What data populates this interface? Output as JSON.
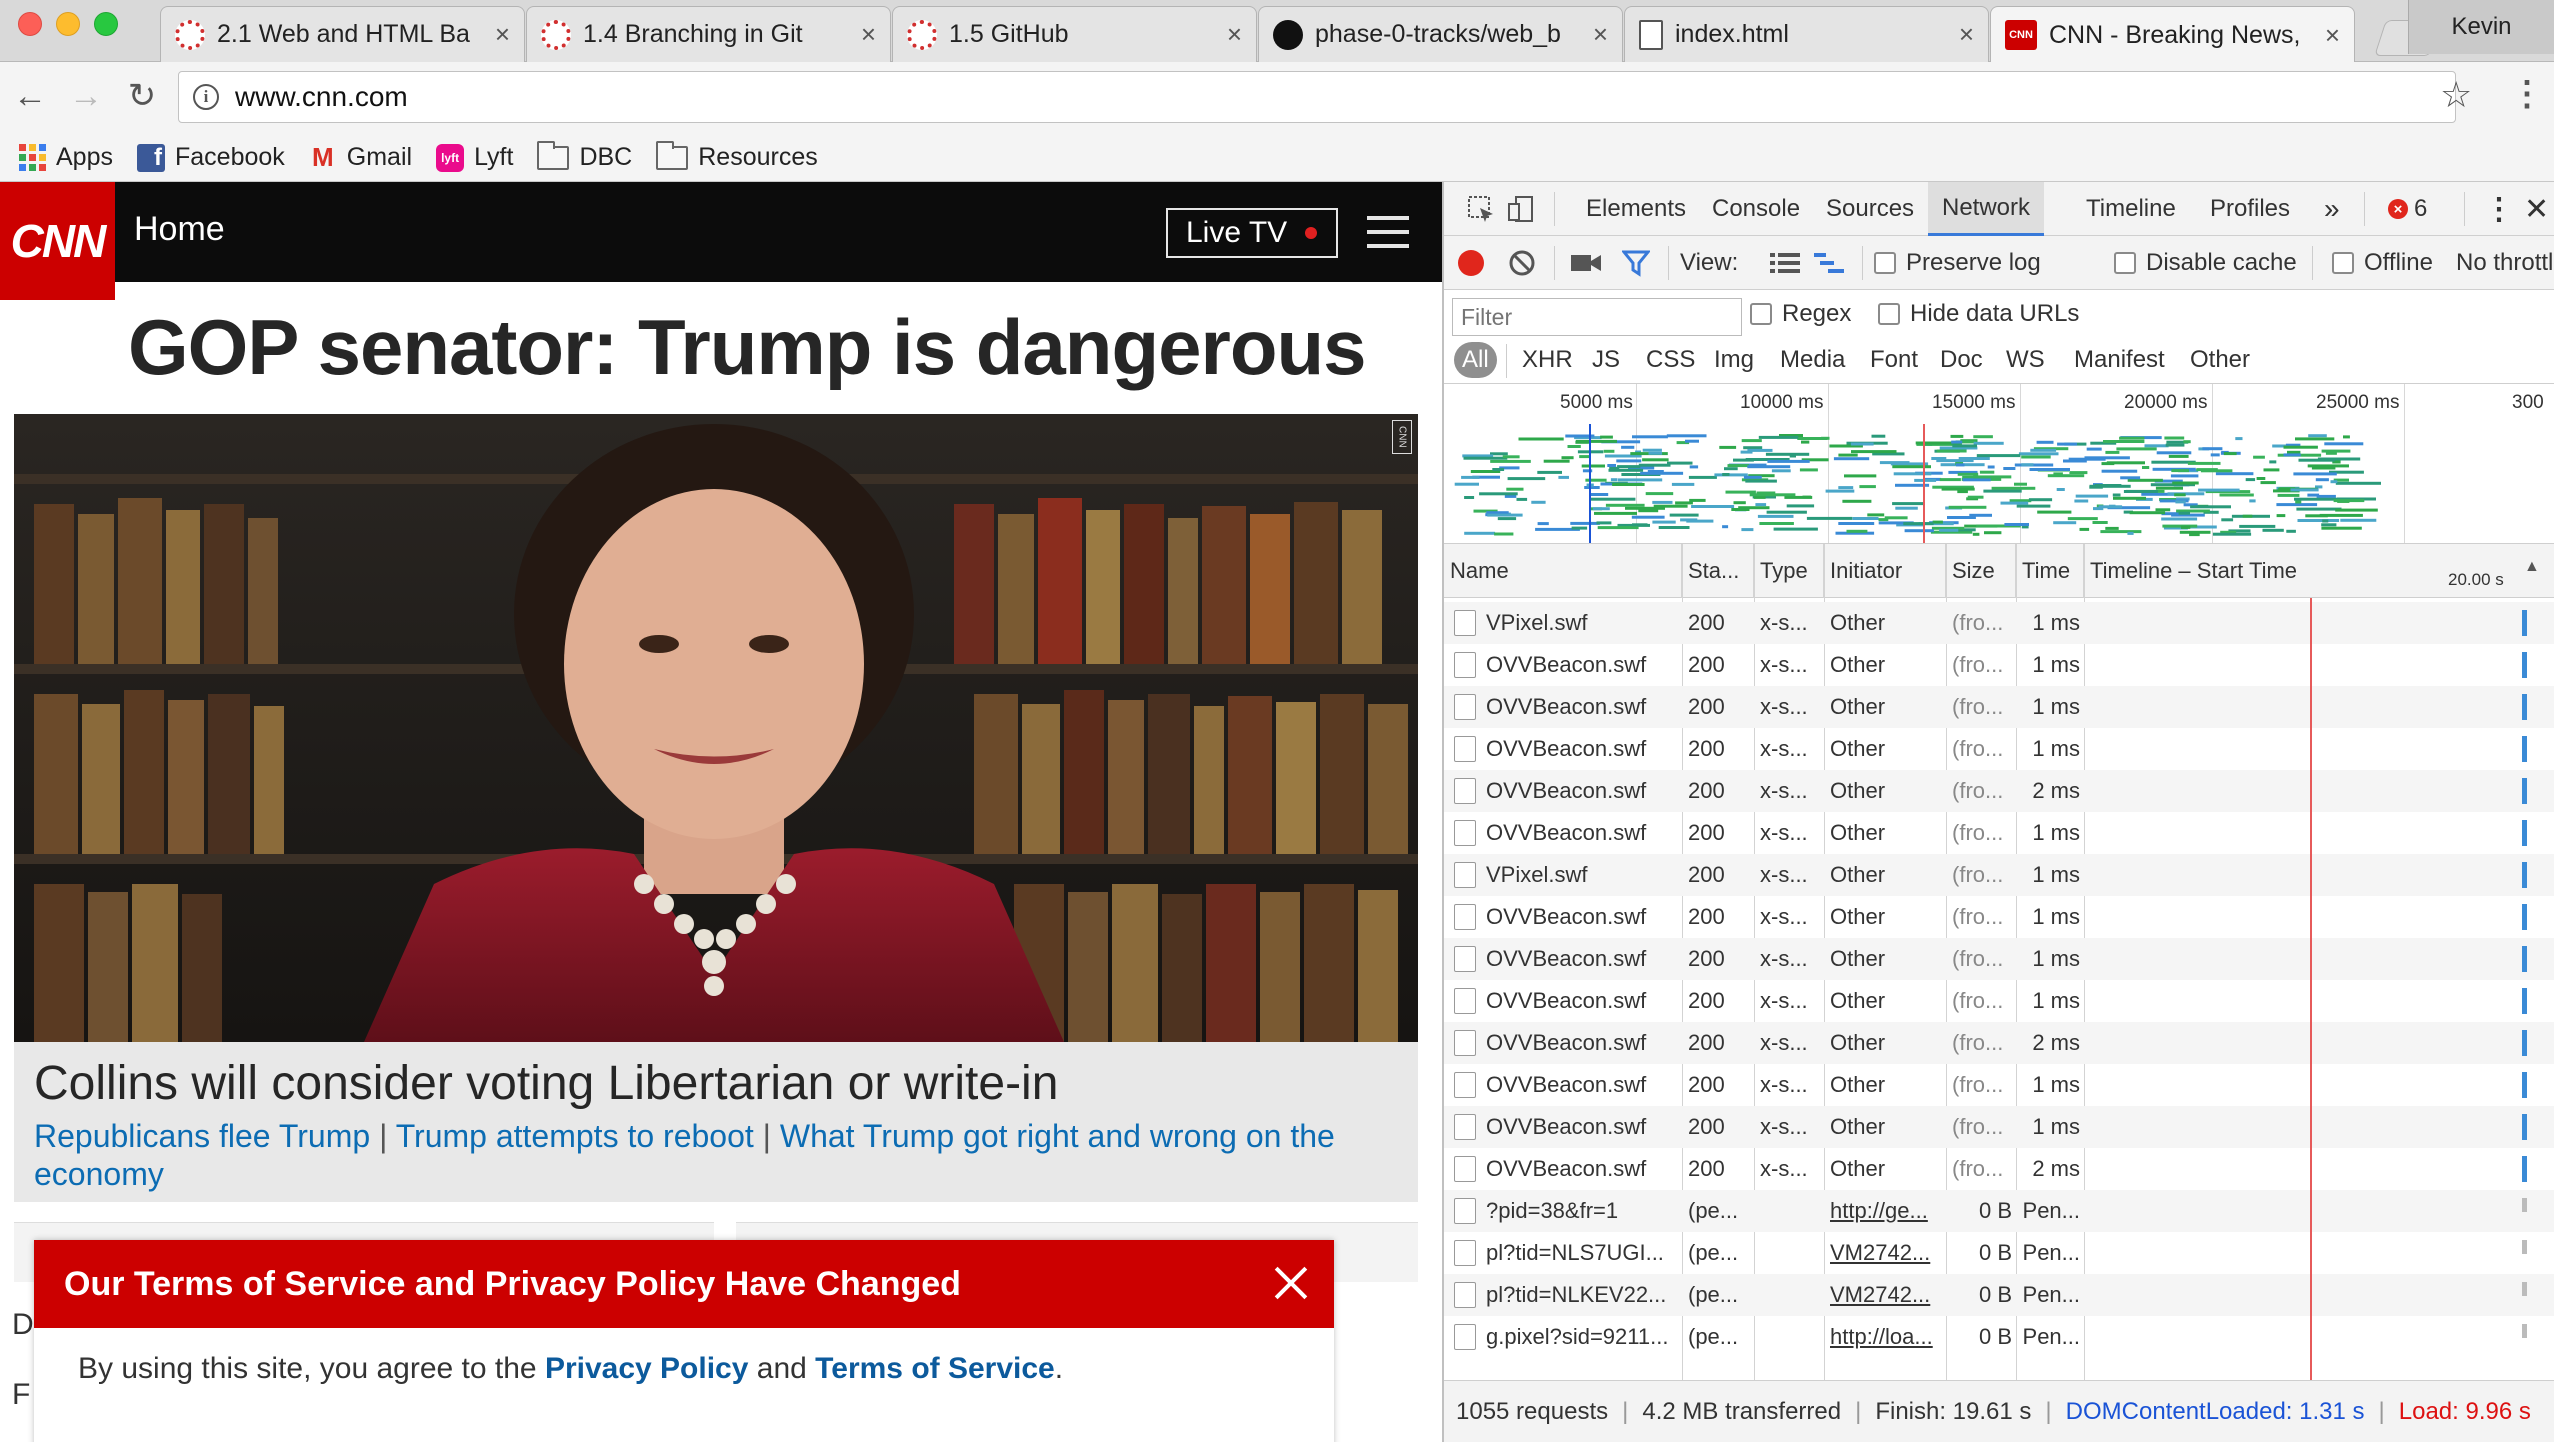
{
  "window": {
    "tabs": [
      {
        "title": "2.1 Web and HTML Ba",
        "icon": "gear-favicon"
      },
      {
        "title": "1.4 Branching in Git",
        "icon": "gear-favicon"
      },
      {
        "title": "1.5 GitHub",
        "icon": "gear-favicon"
      },
      {
        "title": "phase-0-tracks/web_b",
        "icon": "github-favicon"
      },
      {
        "title": "index.html",
        "icon": "document-favicon"
      },
      {
        "title": "CNN - Breaking News,",
        "icon": "cnn-favicon",
        "active": true
      }
    ],
    "tab_close_glyph": "×",
    "profile_name": "Kevin",
    "url": "www.cnn.com"
  },
  "bookmarks": [
    {
      "label": "Apps",
      "icon": "apps-grid-icon"
    },
    {
      "label": "Facebook",
      "icon": "facebook-icon"
    },
    {
      "label": "Gmail",
      "icon": "gmail-icon"
    },
    {
      "label": "Lyft",
      "icon": "lyft-icon"
    },
    {
      "label": "DBC",
      "icon": "folder-icon"
    },
    {
      "label": "Resources",
      "icon": "folder-icon"
    }
  ],
  "cnn": {
    "logo": "CNN",
    "nav_home": "Home",
    "live_tv": "Live TV",
    "headline": "GOP senator: Trump is dangerous",
    "photo_badge": "CNN",
    "caption_title": "Collins will consider voting Libertarian or write-in",
    "caption_links": [
      "Republicans flee Trump",
      "Trump attempts to reboot",
      "What Trump got right and wrong on the economy"
    ],
    "link_separator": "|",
    "cut_letters": [
      "D",
      "F"
    ],
    "tos": {
      "title": "Our Terms of Service and Privacy Policy Have Changed",
      "body_prefix": "By using this site, you agree to the",
      "privacy_link": "Privacy Policy",
      "and": "and",
      "terms_link": "Terms of Service",
      "suffix": "."
    }
  },
  "devtools": {
    "panels": [
      "Elements",
      "Console",
      "Sources",
      "Network",
      "Timeline",
      "Profiles"
    ],
    "active_panel": "Network",
    "more_glyph": "»",
    "error_count": "6",
    "toolbar": {
      "view_label": "View:",
      "preserve_log": "Preserve log",
      "disable_cache": "Disable cache",
      "offline": "Offline",
      "throttling": "No throttl"
    },
    "filter_placeholder": "Filter",
    "regex": "Regex",
    "hide_data_urls": "Hide data URLs",
    "types": [
      "All",
      "XHR",
      "JS",
      "CSS",
      "Img",
      "Media",
      "Font",
      "Doc",
      "WS",
      "Manifest",
      "Other"
    ],
    "overview_ticks": [
      "5000 ms",
      "10000 ms",
      "15000 ms",
      "20000 ms",
      "25000 ms",
      "300"
    ],
    "columns": [
      "Name",
      "Sta...",
      "Type",
      "Initiator",
      "Size",
      "Time",
      "Timeline – Start Time"
    ],
    "timeline_scale": "20.00 s",
    "rows": [
      {
        "name": "VPixel.swf",
        "status": "200",
        "type": "x-s...",
        "initiator": "Other",
        "size": "(fro...",
        "time": "1 ms"
      },
      {
        "name": "OVVBeacon.swf",
        "status": "200",
        "type": "x-s...",
        "initiator": "Other",
        "size": "(fro...",
        "time": "1 ms"
      },
      {
        "name": "OVVBeacon.swf",
        "status": "200",
        "type": "x-s...",
        "initiator": "Other",
        "size": "(fro...",
        "time": "1 ms"
      },
      {
        "name": "OVVBeacon.swf",
        "status": "200",
        "type": "x-s...",
        "initiator": "Other",
        "size": "(fro...",
        "time": "1 ms"
      },
      {
        "name": "OVVBeacon.swf",
        "status": "200",
        "type": "x-s...",
        "initiator": "Other",
        "size": "(fro...",
        "time": "2 ms"
      },
      {
        "name": "OVVBeacon.swf",
        "status": "200",
        "type": "x-s...",
        "initiator": "Other",
        "size": "(fro...",
        "time": "1 ms"
      },
      {
        "name": "VPixel.swf",
        "status": "200",
        "type": "x-s...",
        "initiator": "Other",
        "size": "(fro...",
        "time": "1 ms"
      },
      {
        "name": "OVVBeacon.swf",
        "status": "200",
        "type": "x-s...",
        "initiator": "Other",
        "size": "(fro...",
        "time": "1 ms"
      },
      {
        "name": "OVVBeacon.swf",
        "status": "200",
        "type": "x-s...",
        "initiator": "Other",
        "size": "(fro...",
        "time": "1 ms"
      },
      {
        "name": "OVVBeacon.swf",
        "status": "200",
        "type": "x-s...",
        "initiator": "Other",
        "size": "(fro...",
        "time": "1 ms"
      },
      {
        "name": "OVVBeacon.swf",
        "status": "200",
        "type": "x-s...",
        "initiator": "Other",
        "size": "(fro...",
        "time": "2 ms"
      },
      {
        "name": "OVVBeacon.swf",
        "status": "200",
        "type": "x-s...",
        "initiator": "Other",
        "size": "(fro...",
        "time": "1 ms"
      },
      {
        "name": "OVVBeacon.swf",
        "status": "200",
        "type": "x-s...",
        "initiator": "Other",
        "size": "(fro...",
        "time": "1 ms"
      },
      {
        "name": "OVVBeacon.swf",
        "status": "200",
        "type": "x-s...",
        "initiator": "Other",
        "size": "(fro...",
        "time": "2 ms"
      },
      {
        "name": "?pid=38&fr=1",
        "status": "(pe...",
        "type": "",
        "initiator": "http://ge...",
        "size": "0 B",
        "time": "Pen..."
      },
      {
        "name": "pl?tid=NLS7UGI...",
        "status": "(pe...",
        "type": "",
        "initiator": "VM2742...",
        "size": "0 B",
        "time": "Pen..."
      },
      {
        "name": "pl?tid=NLKEV22...",
        "status": "(pe...",
        "type": "",
        "initiator": "VM2742...",
        "size": "0 B",
        "time": "Pen..."
      },
      {
        "name": "g.pixel?sid=9211...",
        "status": "(pe...",
        "type": "",
        "initiator": "http://loa...",
        "size": "0 B",
        "time": "Pen..."
      }
    ],
    "status_bar": {
      "requests": "1055 requests",
      "transferred": "4.2 MB transferred",
      "finish": "Finish: 19.61 s",
      "dom_content_loaded": "DOMContentLoaded: 1.31 s",
      "load": "Load: 9.96 s",
      "separator": "|"
    }
  },
  "colors": {
    "cnn_red": "#cc0000",
    "link_blue": "#0c6cb3",
    "devtools_active": "#3879d9",
    "record_red": "#e0261c",
    "dcl_blue": "#1a53d6",
    "load_red": "#dd1111"
  }
}
